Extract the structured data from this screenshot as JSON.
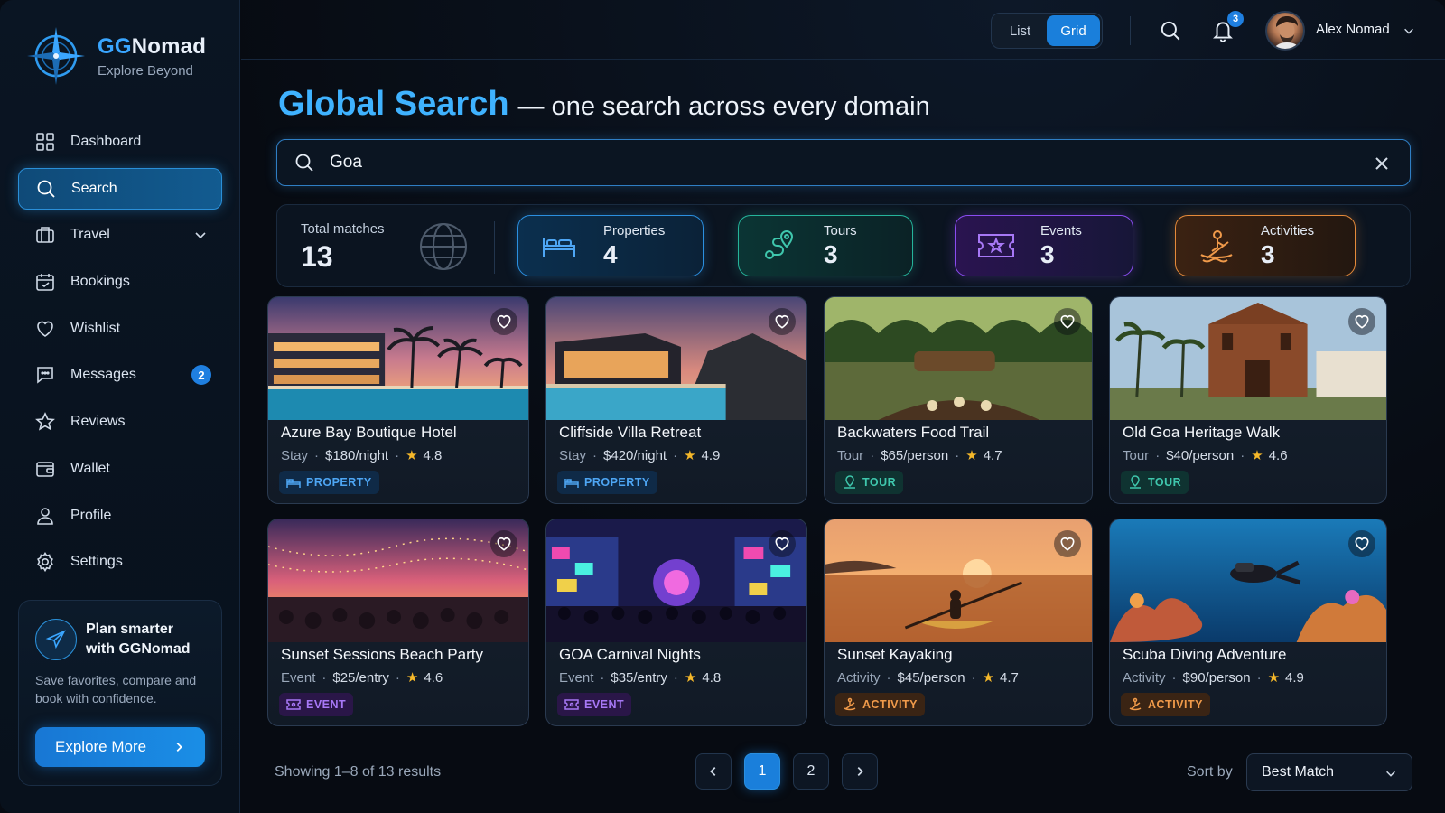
{
  "brand": {
    "name_part1": "GG",
    "name_part2": "Nomad",
    "tagline": "Explore Beyond"
  },
  "sidebar": {
    "items": [
      {
        "label": "Dashboard",
        "icon": "grid-icon"
      },
      {
        "label": "Search",
        "icon": "search-icon",
        "active": true
      },
      {
        "label": "Travel",
        "icon": "suitcase-icon"
      },
      {
        "label": "Bookings",
        "icon": "calendar-icon"
      },
      {
        "label": "Wishlist",
        "icon": "heart-icon"
      },
      {
        "label": "Messages",
        "icon": "chat-icon",
        "badge": "2"
      },
      {
        "label": "Reviews",
        "icon": "star-icon"
      },
      {
        "label": "Wallet",
        "icon": "wallet-icon"
      },
      {
        "label": "Profile",
        "icon": "user-icon"
      },
      {
        "label": "Settings",
        "icon": "gear-icon"
      }
    ],
    "promo": {
      "title": "Plan smarter with GGNomad",
      "text": "Save favorites, compare and book with confidence.",
      "button": "Explore More"
    }
  },
  "topbar": {
    "view_list": "List",
    "view_grid": "Grid",
    "notifications_count": "3",
    "user_name": "Alex Nomad"
  },
  "page": {
    "title": "Global Search",
    "subtitle": "— one search across every domain"
  },
  "search": {
    "value": "Goa"
  },
  "stats": {
    "total_label": "Total matches",
    "total_value": "13",
    "properties": {
      "label": "Properties",
      "value": "4"
    },
    "tours": {
      "label": "Tours",
      "value": "3"
    },
    "events": {
      "label": "Events",
      "value": "3"
    },
    "activities": {
      "label": "Activities",
      "value": "3"
    }
  },
  "results": [
    {
      "title": "Azure Bay Boutique Hotel",
      "category": "Stay",
      "price": "$180/night",
      "rating": "4.8",
      "tag": "PROPERTY",
      "kind": "property"
    },
    {
      "title": "Cliffside Villa Retreat",
      "category": "Stay",
      "price": "$420/night",
      "rating": "4.9",
      "tag": "PROPERTY",
      "kind": "property"
    },
    {
      "title": "Backwaters Food Trail",
      "category": "Tour",
      "price": "$65/person",
      "rating": "4.7",
      "tag": "TOUR",
      "kind": "tour"
    },
    {
      "title": "Old Goa Heritage Walk",
      "category": "Tour",
      "price": "$40/person",
      "rating": "4.6",
      "tag": "TOUR",
      "kind": "tour"
    },
    {
      "title": "Sunset Sessions Beach Party",
      "category": "Event",
      "price": "$25/entry",
      "rating": "4.6",
      "tag": "EVENT",
      "kind": "event"
    },
    {
      "title": "GOA Carnival Nights",
      "category": "Event",
      "price": "$35/entry",
      "rating": "4.8",
      "tag": "EVENT",
      "kind": "event"
    },
    {
      "title": "Sunset Kayaking",
      "category": "Activity",
      "price": "$45/person",
      "rating": "4.7",
      "tag": "ACTIVITY",
      "kind": "activity"
    },
    {
      "title": "Scuba Diving Adventure",
      "category": "Activity",
      "price": "$90/person",
      "rating": "4.9",
      "tag": "ACTIVITY",
      "kind": "activity"
    }
  ],
  "footer": {
    "showing": "Showing 1–8 of 13 results",
    "pages": [
      "1",
      "2"
    ],
    "current_page": "1",
    "sort_label": "Sort by",
    "sort_value": "Best Match"
  },
  "colors": {
    "accent": "#1a7fdb",
    "property": "#2b8fe0",
    "tour": "#25b49b",
    "event": "#8a4cf0",
    "activity": "#e58a3a"
  }
}
